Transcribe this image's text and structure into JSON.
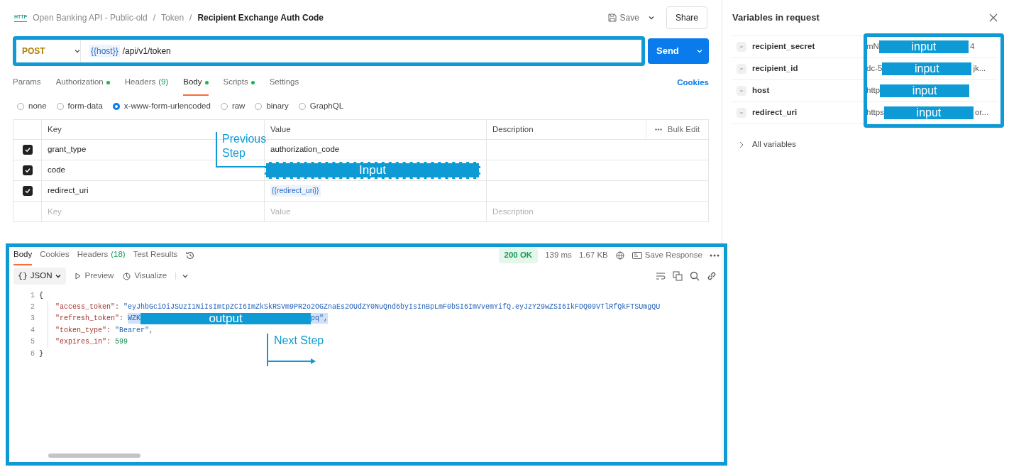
{
  "breadcrumb": {
    "badge": "HTTP",
    "path": [
      {
        "label": "Open Banking API - Public-old",
        "separator": "/"
      },
      {
        "label": "Token",
        "separator": "/"
      }
    ],
    "current": "Recipient Exchange Auth Code"
  },
  "header_actions": {
    "save": "Save",
    "share": "Share"
  },
  "request": {
    "method": "POST",
    "url_variable": "{{host}}",
    "url_path": "/api/v1/token",
    "send": "Send"
  },
  "request_tabs": [
    {
      "label": "Params",
      "dot": false,
      "selected": false
    },
    {
      "label": "Authorization",
      "dot": true,
      "selected": false
    },
    {
      "label": "Headers",
      "count": "(9)",
      "dot": false,
      "selected": false
    },
    {
      "label": "Body",
      "dot": true,
      "selected": true
    },
    {
      "label": "Scripts",
      "dot": true,
      "selected": false
    },
    {
      "label": "Settings",
      "dot": false,
      "selected": false
    }
  ],
  "cookies_link": "Cookies",
  "body_types": [
    {
      "label": "none",
      "selected": false
    },
    {
      "label": "form-data",
      "selected": false
    },
    {
      "label": "x-www-form-urlencoded",
      "selected": true
    },
    {
      "label": "raw",
      "selected": false
    },
    {
      "label": "binary",
      "selected": false
    },
    {
      "label": "GraphQL",
      "selected": false
    }
  ],
  "params_table": {
    "columns": [
      "Key",
      "Value",
      "Description"
    ],
    "bulk_edit": "Bulk Edit",
    "rows": [
      {
        "checked": true,
        "key": "grant_type",
        "kind": "text",
        "value": "authorization_code"
      },
      {
        "checked": true,
        "key": "code",
        "kind": "redacted",
        "value": "Input"
      },
      {
        "checked": true,
        "key": "redirect_uri",
        "kind": "variable",
        "value": "{{redirect_uri}}"
      }
    ],
    "new_row": {
      "key": {
        "placeholder": "Key"
      },
      "value": {
        "placeholder": "Value"
      },
      "description": {
        "placeholder": "Description"
      }
    }
  },
  "annotations": [
    {
      "kind": "previous",
      "lines": [
        "Previous",
        "Step"
      ]
    },
    {
      "kind": "next",
      "lines": [
        "Next Step"
      ]
    }
  ],
  "response_tabs": [
    {
      "label": "Body",
      "selected": true
    },
    {
      "label": "Cookies",
      "selected": false
    },
    {
      "label": "Headers",
      "count": "(18)",
      "selected": false
    },
    {
      "label": "Test Results",
      "selected": false
    }
  ],
  "response_status": {
    "status": "200 OK",
    "time": "139 ms",
    "size": "1.67 KB",
    "save": "Save Response"
  },
  "response_toolbar": {
    "format": "JSON",
    "format_icon": "{}",
    "preview": "Preview",
    "visualize": "Visualize"
  },
  "code_lines": [
    {
      "number": "1",
      "kind": "brace",
      "text": "{"
    },
    {
      "number": "2",
      "kind": "string",
      "key": "\"access_token\":",
      "value": "\"eyJhbGciOiJSUzI1NiIsImtpZCI6ImZkSkRSVm9PR2o2OGZnaEs2OUdZY0NuQnd6byIsInBpLmF0bSI6ImVvemYifQ.eyJzY29wZSI6IkFDQ09VTlRfQkFTSUmgQU"
    },
    {
      "number": "3",
      "kind": "redacted",
      "key": "\"refresh_token\":",
      "start": "WZK",
      "label": "output",
      "end": "pq\","
    },
    {
      "number": "4",
      "kind": "string",
      "key": "\"token_type\":",
      "value": "\"Bearer\","
    },
    {
      "number": "5",
      "kind": "number",
      "key": "\"expires_in\":",
      "value": "599"
    },
    {
      "number": "6",
      "kind": "brace",
      "text": "}"
    }
  ],
  "variables_panel": {
    "title": "Variables in request",
    "variables": [
      {
        "name": "recipient_secret",
        "start": "mN",
        "label": "input",
        "end": "4"
      },
      {
        "name": "recipient_id",
        "start": "dc-5",
        "label": "input",
        "end": "jk..."
      },
      {
        "name": "host",
        "start": "http",
        "label": "input"
      },
      {
        "name": "redirect_uri",
        "start": "https",
        "label": "input",
        "end": "or..."
      }
    ],
    "all_variables": "All variables"
  }
}
